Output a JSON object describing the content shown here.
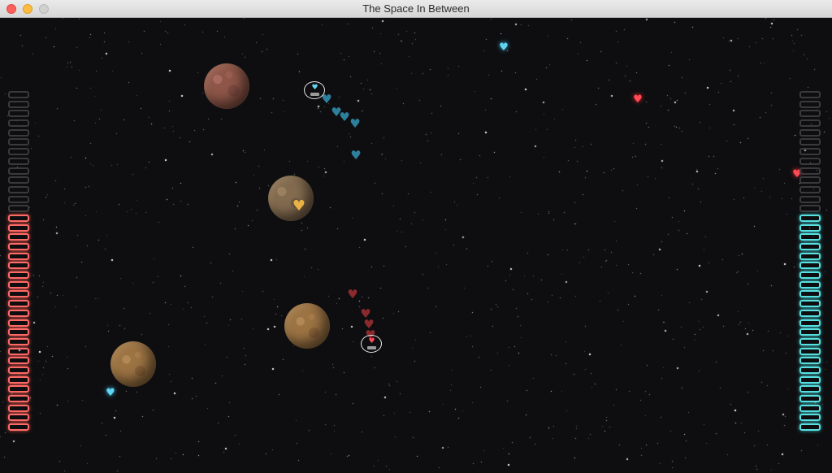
{
  "window": {
    "title": "The Space In Between"
  },
  "colors": {
    "player_red": "#ff4b55",
    "player_blue": "#5fd5f0",
    "meter_red": "#ff6b66",
    "meter_blue": "#58e0e0",
    "background": "#0e0e10"
  },
  "meters": {
    "red_player": {
      "segments": 36,
      "filled": 23
    },
    "blue_player": {
      "segments": 36,
      "filled": 23
    }
  },
  "icons": {
    "heart": "heart-icon",
    "ship": "ship-icon"
  }
}
